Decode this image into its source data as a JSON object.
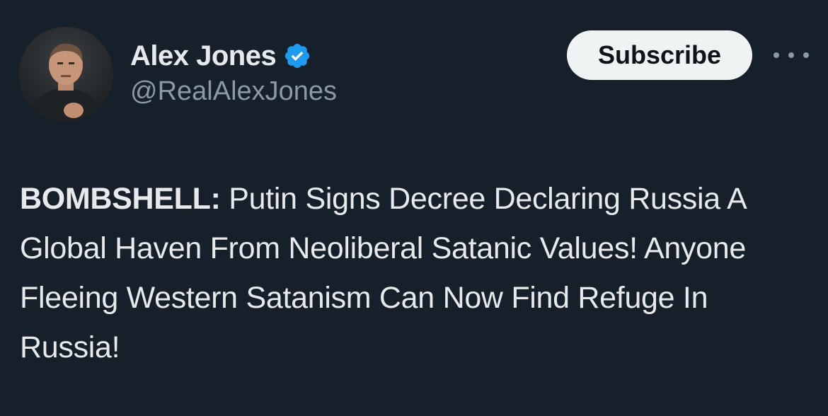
{
  "author": {
    "display_name": "Alex Jones",
    "handle": "@RealAlexJones",
    "verified": true,
    "avatar_icon": "profile-photo"
  },
  "actions": {
    "subscribe_label": "Subscribe",
    "more_icon": "more-options-icon"
  },
  "tweet": {
    "lead": "BOMBSHELL:",
    "body": " Putin Signs Decree Declaring Russia A Global Haven From Neoliberal Satanic Values! Anyone Fleeing Western Satanism Can Now Find Refuge In Russia!"
  },
  "colors": {
    "background": "#15202b",
    "text_primary": "#e7e9ea",
    "text_secondary": "#8b98a5",
    "verified_blue": "#1d9bf0",
    "button_bg": "#eff3f4",
    "button_text": "#0f1419"
  }
}
